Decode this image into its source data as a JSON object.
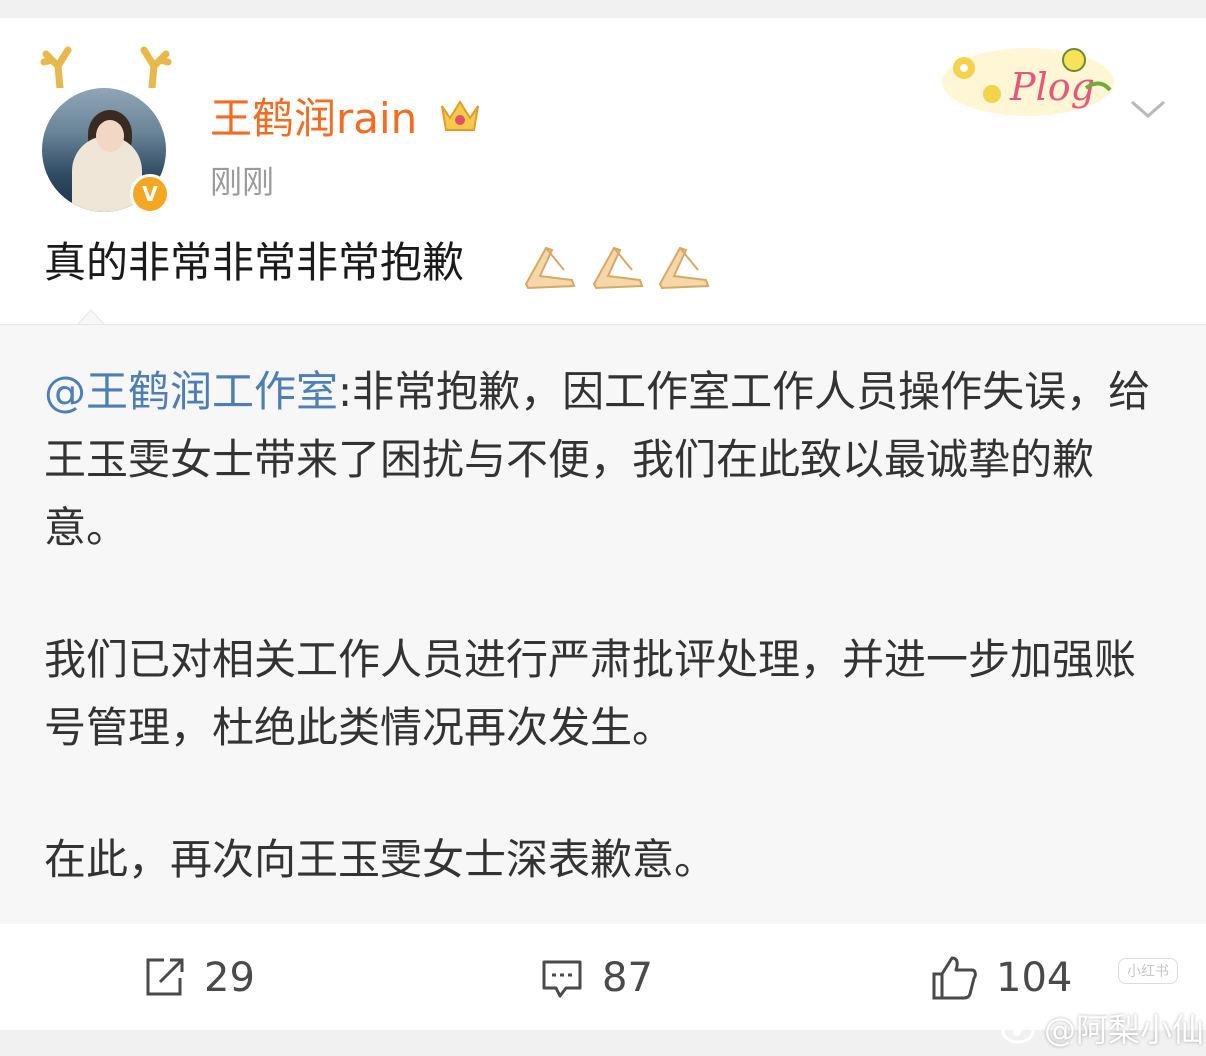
{
  "post": {
    "author": "王鹤润rain",
    "timestamp": "刚刚",
    "text": "真的非常非常非常抱歉",
    "emojis": [
      "praying-hands",
      "praying-hands",
      "praying-hands"
    ]
  },
  "repost": {
    "mention": "@王鹤润工作室",
    "para1": ":非常抱歉，因工作室工作人员操作失误，给王玉雯女士带来了困扰与不便，我们在此致以最诚挚的歉意。",
    "para2": "我们已对相关工作人员进行严肃批评处理，并进一步加强账号管理，杜绝此类情况再次发生。",
    "para3": "在此，再次向王玉雯女士深表歉意。"
  },
  "actions": {
    "repost_count": "29",
    "comment_count": "87",
    "like_count": "104"
  },
  "decor": {
    "plog": "Plog",
    "xhs_mark": "小红书"
  },
  "watermark": "@阿梨小仙",
  "colors": {
    "username": "#f26d21",
    "mention": "#4d7fb5",
    "verify": "#f5a623"
  },
  "icons": [
    "antler-icon",
    "verified-badge-icon",
    "crown-icon",
    "chevron-down-icon",
    "repost-icon",
    "comment-icon",
    "like-icon",
    "weibo-logo-icon"
  ]
}
